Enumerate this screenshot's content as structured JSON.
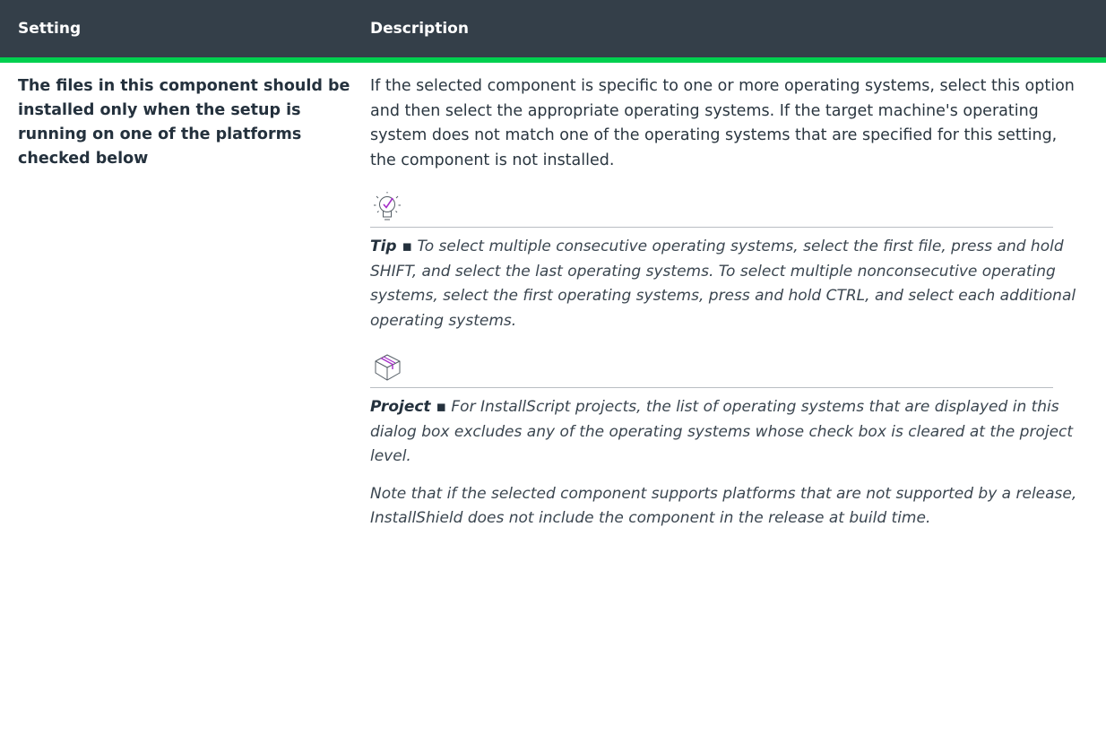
{
  "header": {
    "col_setting": "Setting",
    "col_description": "Description"
  },
  "row": {
    "setting": "The files in this component should be installed only when the setup is running on one of the platforms checked below",
    "description": "If the selected component is specific to one or more operating systems, select this option and then select the appropriate operating systems. If the target machine's operating system does not match one of the operating systems that are specified for this setting, the component is not installed.",
    "tip": {
      "icon": "lightbulb-check-icon",
      "label": "Tip ▪",
      "text": " To select multiple consecutive operating systems, select the first file, press and hold SHIFT, and select the last operating systems. To select multiple nonconsecutive operating systems, select the first operating systems, press and hold CTRL, and select each additional operating systems."
    },
    "project": {
      "icon": "box-icon",
      "label": "Project ▪",
      "text": " For InstallScript projects, the list of operating systems that are displayed in this dialog box excludes any of the operating systems whose check box is cleared at the project level.",
      "extra": "Note that if the selected component supports platforms that are not supported by a release, InstallShield does not include the component in the release at build time."
    }
  },
  "colors": {
    "header_bg": "#343f49",
    "header_accent": "#00d04f",
    "icon_accent": "#a52ec9"
  }
}
